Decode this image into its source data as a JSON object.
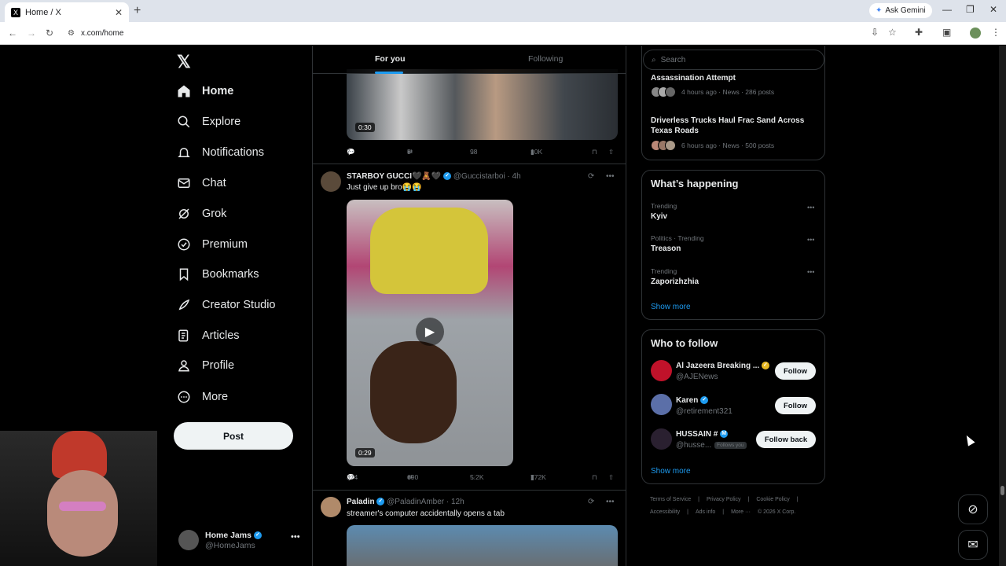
{
  "browser": {
    "tab_title": "Home / X",
    "tab_favicon": "X",
    "ask_gemini": "Ask Gemini",
    "url": "x.com/home"
  },
  "sidebar": {
    "logo": "X",
    "items": [
      {
        "label": "Home",
        "icon": "home-icon"
      },
      {
        "label": "Explore",
        "icon": "search-icon"
      },
      {
        "label": "Notifications",
        "icon": "bell-icon"
      },
      {
        "label": "Chat",
        "icon": "mail-icon"
      },
      {
        "label": "Grok",
        "icon": "grok-icon"
      },
      {
        "label": "Premium",
        "icon": "verified-icon"
      },
      {
        "label": "Bookmarks",
        "icon": "bookmark-icon"
      },
      {
        "label": "Creator Studio",
        "icon": "rocket-icon"
      },
      {
        "label": "Articles",
        "icon": "article-icon"
      },
      {
        "label": "Profile",
        "icon": "person-icon"
      },
      {
        "label": "More",
        "icon": "more-circle-icon"
      }
    ],
    "post_label": "Post",
    "account": {
      "name": "Home Jams",
      "handle": "@HomeJams"
    }
  },
  "feed": {
    "tabs": [
      "For you",
      "Following"
    ],
    "post1": {
      "duration": "0:30",
      "replies": "7",
      "reposts": "5",
      "likes": "98",
      "views": "10K"
    },
    "post2": {
      "name": "STARBOY GUCCI🖤🧸🖤",
      "handle": "@Guccistarboi",
      "time": "· 4h",
      "text": "Just give up bro😭😭",
      "duration": "0:29",
      "replies": "374",
      "reposts": "690",
      "likes": "5.2K",
      "views": "772K"
    },
    "post3": {
      "name": "Paladin",
      "handle": "@PaladinAmber",
      "time": "· 12h",
      "text": "streamer's computer accidentally opens a tab"
    }
  },
  "right": {
    "search_placeholder": "Search",
    "news": [
      {
        "title": "Assassination Attempt",
        "meta": "4 hours ago · News · 286 posts"
      },
      {
        "title": "Driverless Trucks Haul Frac Sand Across Texas Roads",
        "meta": "6 hours ago · News · 500 posts"
      }
    ],
    "happening": {
      "title": "What’s happening",
      "trends": [
        {
          "context": "Trending",
          "name": "Kyiv"
        },
        {
          "context": "Politics · Trending",
          "name": "Treason"
        },
        {
          "context": "Trending",
          "name": "Zaporizhzhia"
        }
      ],
      "show_more": "Show more"
    },
    "who_to_follow": {
      "title": "Who to follow",
      "accounts": [
        {
          "name": "Al Jazeera Breaking ...",
          "handle": "@AJENews",
          "button": "Follow"
        },
        {
          "name": "Karen",
          "handle": "@retirement321",
          "button": "Follow"
        },
        {
          "name": "HUSSAIN #",
          "handle": "@husse...",
          "follows_you": "Follows you",
          "button": "Follow back"
        }
      ],
      "show_more": "Show more"
    },
    "footer": [
      "Terms of Service",
      "|",
      "Privacy Policy",
      "|",
      "Cookie Policy",
      "|",
      "Accessibility",
      "|",
      "Ads info",
      "|",
      "More ···",
      "© 2026 X Corp."
    ]
  }
}
